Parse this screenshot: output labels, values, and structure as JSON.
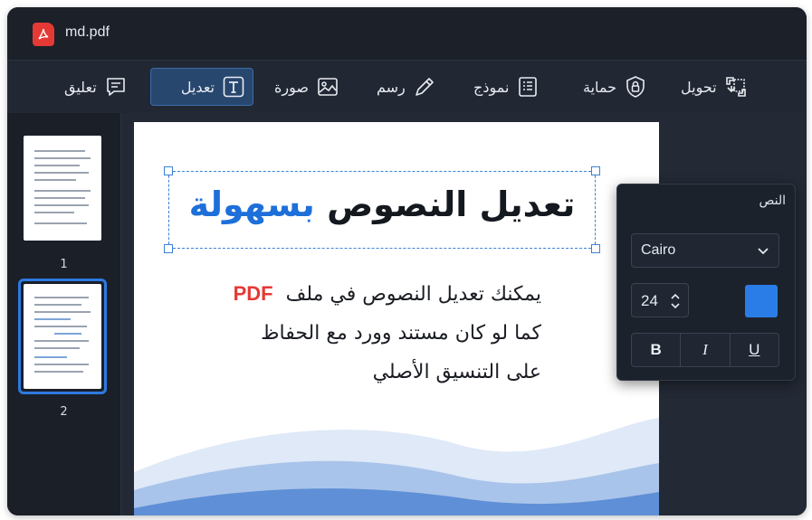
{
  "window": {
    "filename": "md.pdf",
    "logo_text": "A"
  },
  "toolbar": {
    "items": [
      {
        "id": "convert",
        "label": "تحويل",
        "icon": "convert-icon"
      },
      {
        "id": "protect",
        "label": "حماية",
        "icon": "lock-icon"
      },
      {
        "id": "form",
        "label": "نموذج",
        "icon": "form-icon"
      },
      {
        "id": "draw",
        "label": "رسم",
        "icon": "pen-icon"
      },
      {
        "id": "image",
        "label": "صورة",
        "icon": "image-icon"
      },
      {
        "id": "edit",
        "label": "تعديل",
        "icon": "text-icon",
        "active": true
      },
      {
        "id": "comment",
        "label": "تعليق",
        "icon": "comment-icon"
      }
    ]
  },
  "thumbnails": {
    "pages": [
      "1",
      "2"
    ],
    "selected": "2"
  },
  "document": {
    "headline_dark": "تعديل النصوص",
    "headline_blue": "بسهولة",
    "line1_text": "يمكنك تعديل النصوص في ملف",
    "line1_pdf": "PDF",
    "line2": "كما لو كان مستند وورد مع الحفاظ",
    "line3": "على التنسيق الأصلي"
  },
  "text_panel": {
    "title": "النص",
    "font": "Cairo",
    "size": "24",
    "color": "#2a7de6",
    "bold_label": "B",
    "italic_label": "I",
    "underline_label": "U"
  },
  "colors": {
    "accent": "#2d7ae0",
    "pdf_red": "#e53935",
    "headline_blue": "#1e6fd9"
  }
}
